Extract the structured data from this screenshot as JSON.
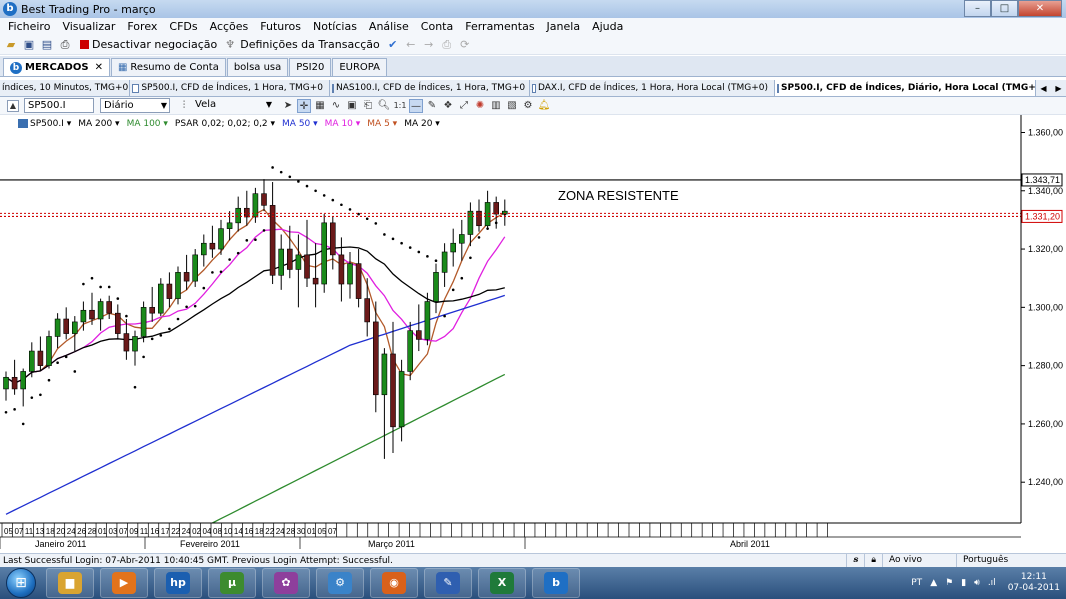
{
  "window": {
    "title": "Best Trading Pro - março",
    "minimize": "–",
    "maximize": "□",
    "close": "✕"
  },
  "menu": [
    "Ficheiro",
    "Visualizar",
    "Forex",
    "CFDs",
    "Acções",
    "Futuros",
    "Notícias",
    "Análise",
    "Conta",
    "Ferramentas",
    "Janela",
    "Ajuda"
  ],
  "toolbar": {
    "deactivate_label": "Desactivar negociação",
    "settings_label": "Definições da Transacção"
  },
  "workspace_tabs": [
    {
      "label": "MERCADOS",
      "active": true
    },
    {
      "label": "Resumo de Conta",
      "active": false
    },
    {
      "label": "bolsa usa",
      "active": false
    },
    {
      "label": "PSI20",
      "active": false
    },
    {
      "label": "EUROPA",
      "active": false
    }
  ],
  "chart_tabs": [
    {
      "label": "índices, 10 Minutos, TMG+0",
      "active": false
    },
    {
      "label": "SP500.I, CFD de Índices, 1 Hora, TMG+0",
      "active": false
    },
    {
      "label": "NAS100.I, CFD de Índices, 1 Hora, TMG+0",
      "active": false
    },
    {
      "label": "DAX.I, CFD de Índices, 1 Hora, Hora Local (TMG+0)",
      "active": false
    },
    {
      "label": "SP500.I, CFD de Índices, Diário, Hora Local (TMG+0)",
      "active": true
    }
  ],
  "chart_toolbar": {
    "symbol": "SP500.I",
    "period": "Diário",
    "style": "Vela"
  },
  "legend": [
    {
      "label": "SP500.I ▾",
      "color": "#000000"
    },
    {
      "label": "MA 200 ▾",
      "color": "#000000"
    },
    {
      "label": "MA 100 ▾",
      "color": "#2e8b2e"
    },
    {
      "label": "PSAR 0,02; 0,02; 0,2 ▾",
      "color": "#000000"
    },
    {
      "label": "MA 50 ▾",
      "color": "#1f2fd0"
    },
    {
      "label": "MA 10 ▾",
      "color": "#e020e0"
    },
    {
      "label": "MA 5 ▾",
      "color": "#c05020"
    },
    {
      "label": "MA 20 ▾",
      "color": "#000000"
    }
  ],
  "chart_data": {
    "type": "candlestick",
    "y_ticks": [
      "1.360,00",
      "1.340,00",
      "1.320,00",
      "1.300,00",
      "1.280,00",
      "1.260,00",
      "1.240,00"
    ],
    "ylim": [
      1226,
      1366
    ],
    "x_labels": [
      "05",
      "07",
      "11",
      "13",
      "18",
      "20",
      "24",
      "26",
      "28",
      "01",
      "03",
      "07",
      "09",
      "11",
      "16",
      "17",
      "22",
      "24",
      "02",
      "04",
      "08",
      "10",
      "14",
      "16",
      "18",
      "22",
      "24",
      "28",
      "30",
      "01",
      "05",
      "07"
    ],
    "month_labels": [
      "Janeiro 2011",
      "Fevereiro 2011",
      "Março 2011",
      "Abril 2011"
    ],
    "annotation": "ZONA RESISTENTE",
    "levels": [
      {
        "value": 1343.71,
        "label": "1.343,71",
        "color": "#000000"
      },
      {
        "value": 1331.2,
        "label": "1.331,20",
        "color": "#d00000"
      }
    ],
    "candles": [
      [
        1272,
        1278,
        1268,
        1276
      ],
      [
        1276,
        1282,
        1270,
        1272
      ],
      [
        1272,
        1279,
        1266,
        1278
      ],
      [
        1278,
        1288,
        1276,
        1285
      ],
      [
        1285,
        1290,
        1278,
        1280
      ],
      [
        1280,
        1292,
        1279,
        1290
      ],
      [
        1290,
        1298,
        1286,
        1296
      ],
      [
        1296,
        1300,
        1289,
        1291
      ],
      [
        1291,
        1297,
        1285,
        1295
      ],
      [
        1295,
        1302,
        1292,
        1299
      ],
      [
        1299,
        1305,
        1294,
        1296
      ],
      [
        1296,
        1303,
        1292,
        1302
      ],
      [
        1302,
        1304,
        1296,
        1298
      ],
      [
        1298,
        1301,
        1289,
        1291
      ],
      [
        1291,
        1296,
        1282,
        1285
      ],
      [
        1285,
        1292,
        1280,
        1290
      ],
      [
        1290,
        1302,
        1288,
        1300
      ],
      [
        1300,
        1307,
        1295,
        1298
      ],
      [
        1298,
        1310,
        1297,
        1308
      ],
      [
        1308,
        1312,
        1300,
        1303
      ],
      [
        1303,
        1314,
        1301,
        1312
      ],
      [
        1312,
        1318,
        1306,
        1309
      ],
      [
        1309,
        1320,
        1307,
        1318
      ],
      [
        1318,
        1325,
        1314,
        1322
      ],
      [
        1322,
        1328,
        1317,
        1320
      ],
      [
        1320,
        1330,
        1318,
        1327
      ],
      [
        1327,
        1333,
        1323,
        1329
      ],
      [
        1329,
        1338,
        1326,
        1334
      ],
      [
        1334,
        1340,
        1328,
        1331
      ],
      [
        1331,
        1341,
        1329,
        1339
      ],
      [
        1339,
        1344,
        1333,
        1335
      ],
      [
        1335,
        1343,
        1308,
        1311
      ],
      [
        1311,
        1325,
        1306,
        1320
      ],
      [
        1320,
        1328,
        1310,
        1313
      ],
      [
        1313,
        1325,
        1300,
        1318
      ],
      [
        1318,
        1330,
        1307,
        1310
      ],
      [
        1310,
        1322,
        1300,
        1308
      ],
      [
        1308,
        1332,
        1305,
        1329
      ],
      [
        1329,
        1331,
        1313,
        1318
      ],
      [
        1318,
        1324,
        1302,
        1308
      ],
      [
        1308,
        1319,
        1303,
        1315
      ],
      [
        1315,
        1320,
        1300,
        1303
      ],
      [
        1303,
        1310,
        1290,
        1295
      ],
      [
        1295,
        1302,
        1264,
        1270
      ],
      [
        1270,
        1286,
        1248,
        1284
      ],
      [
        1284,
        1295,
        1250,
        1259
      ],
      [
        1259,
        1282,
        1254,
        1278
      ],
      [
        1278,
        1295,
        1275,
        1292
      ],
      [
        1292,
        1301,
        1285,
        1289
      ],
      [
        1289,
        1305,
        1287,
        1302
      ],
      [
        1302,
        1315,
        1298,
        1312
      ],
      [
        1312,
        1322,
        1307,
        1319
      ],
      [
        1319,
        1327,
        1314,
        1322
      ],
      [
        1322,
        1330,
        1316,
        1325
      ],
      [
        1325,
        1336,
        1321,
        1333
      ],
      [
        1333,
        1337,
        1326,
        1328
      ],
      [
        1328,
        1340,
        1327,
        1336
      ],
      [
        1336,
        1338,
        1327,
        1332
      ],
      [
        1332,
        1337,
        1328,
        1333
      ]
    ]
  },
  "status": {
    "login": "Last Successful Login: 07-Abr-2011 10:40:45 GMT. Previous Login Attempt: Successful.",
    "live": "Ao vivo",
    "language": "Português"
  },
  "taskbar": {
    "apps": [
      {
        "name": "explorer",
        "color": "#d9a431",
        "glyph": "▆"
      },
      {
        "name": "media",
        "color": "#e2731b",
        "glyph": "▶"
      },
      {
        "name": "hp",
        "color": "#1b5fb0",
        "glyph": "hp"
      },
      {
        "name": "utorrent",
        "color": "#3d8b2f",
        "glyph": "µ"
      },
      {
        "name": "paint",
        "color": "#8e3f9c",
        "glyph": "✿"
      },
      {
        "name": "network",
        "color": "#3a83c9",
        "glyph": "⚙"
      },
      {
        "name": "firefox",
        "color": "#d9611a",
        "glyph": "◉"
      },
      {
        "name": "editor",
        "color": "#2f5fb0",
        "glyph": "✎"
      },
      {
        "name": "excel",
        "color": "#1f7a3a",
        "glyph": "X"
      },
      {
        "name": "trading",
        "color": "#1f6fc4",
        "glyph": "b"
      }
    ],
    "lang": "PT",
    "time": "12:11",
    "date": "07-04-2011"
  }
}
